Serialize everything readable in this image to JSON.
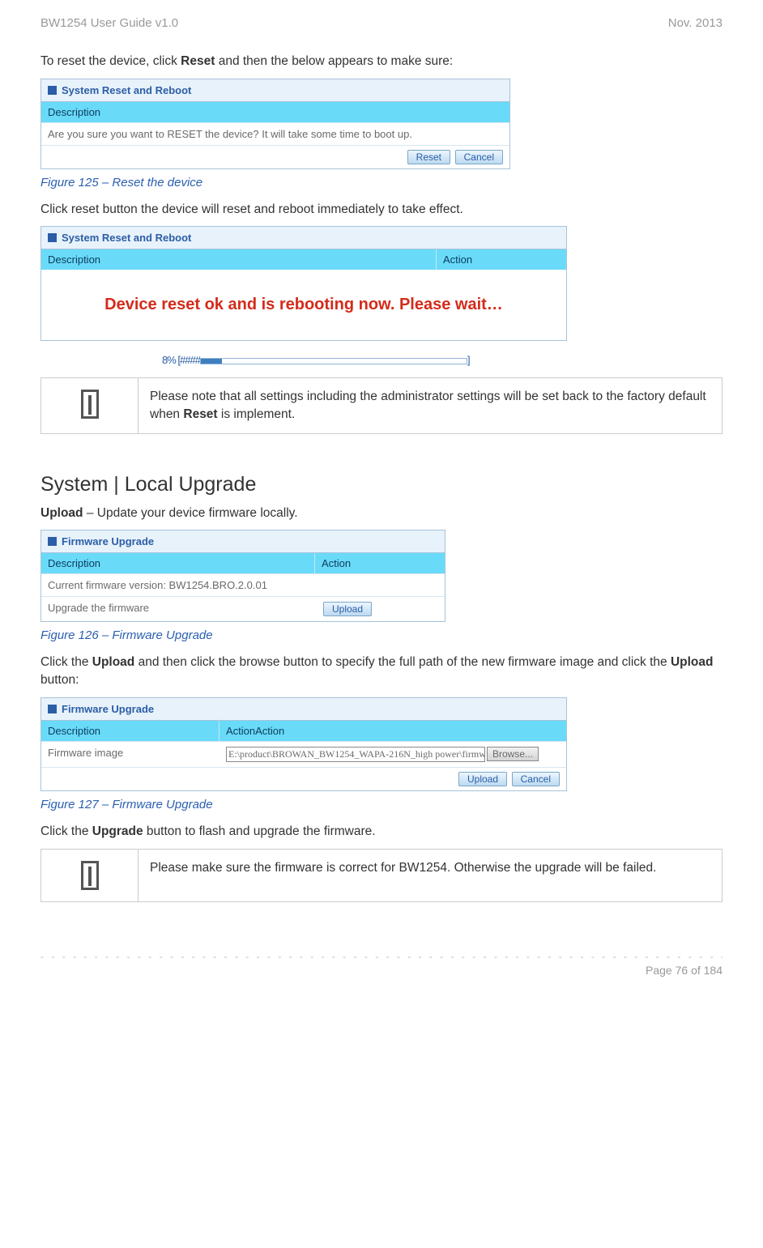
{
  "header": {
    "left": "BW1254 User Guide v1.0",
    "right": "Nov.  2013"
  },
  "intro_reset": {
    "pre": "To reset the device, click ",
    "bold": "Reset",
    "post": " and then the below appears to make sure:"
  },
  "panel_reset1": {
    "title": "System Reset and Reboot",
    "desc_header": "Description",
    "question": "Are you sure you want to RESET the device? It will take some time to boot up.",
    "btn_reset": "Reset",
    "btn_cancel": "Cancel"
  },
  "caption125": "Figure 125 – Reset the device",
  "after_reset": "Click reset button the device will reset and reboot immediately to take effect.",
  "panel_reset2": {
    "title": "System Reset and Reboot",
    "desc_header": "Description",
    "action_header": "Action",
    "msg": "Device reset ok and is rebooting now. Please wait…",
    "progress_label": "8% [####",
    "progress_end": "]"
  },
  "note1": {
    "pre": "Please note that all settings including the administrator settings will be set back to the factory default when ",
    "bold": "Reset",
    "post": " is implement."
  },
  "section_heading": "System | Local Upgrade",
  "upload_line": {
    "bold": "Upload",
    "post": " – Update your device firmware locally."
  },
  "panel_fw1": {
    "title": "Firmware Upgrade",
    "desc_header": "Description",
    "action_header": "Action",
    "row1": "Current firmware version: BW1254.BRO.2.0.01",
    "row2": "Upgrade the firmware",
    "btn_upload": "Upload"
  },
  "caption126": "Figure 126 – Firmware Upgrade",
  "upload_instr": {
    "pre": "Click the ",
    "b1": "Upload",
    "mid": " and then click the browse button to specify the full path of the new firmware image and click the ",
    "b2": "Upload",
    "post": " button:"
  },
  "panel_fw2": {
    "title": "Firmware Upgrade",
    "desc_header": "Description",
    "action_header": "ActionAction",
    "row_label": "Firmware image",
    "path": "E:\\product\\BROWAN_BW1254_WAPA-216N_high power\\firmw",
    "btn_browse": "Browse...",
    "btn_upload": "Upload",
    "btn_cancel": "Cancel"
  },
  "caption127": "Figure 127 – Firmware Upgrade",
  "upgrade_line": {
    "pre": "Click the ",
    "bold": "Upgrade",
    "post": " button to flash and upgrade the firmware."
  },
  "note2": "Please make sure the firmware is correct for BW1254. Otherwise the upgrade will be failed.",
  "footer": "Page 76 of 184"
}
